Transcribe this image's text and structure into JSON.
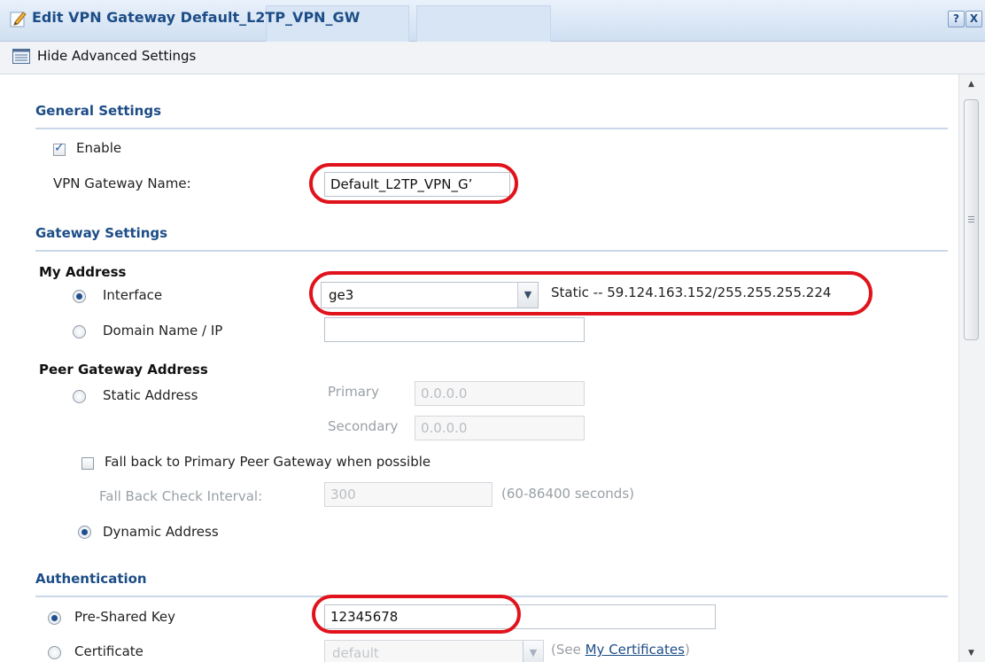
{
  "window": {
    "title": "Edit VPN Gateway Default_L2TP_VPN_GW",
    "help_label": "?",
    "close_label": "X"
  },
  "toolbar": {
    "toggle_label": "Hide Advanced Settings"
  },
  "general": {
    "heading": "General Settings",
    "enable_label": "Enable",
    "enable_checked": true,
    "name_label": "VPN Gateway Name:",
    "name_value": "Default_L2TP_VPN_Gʼ"
  },
  "gateway": {
    "heading": "Gateway Settings",
    "my_address_label": "My Address",
    "interface_label": "Interface",
    "interface_value": "ge3",
    "interface_info": "Static -- 59.124.163.152/255.255.255.224",
    "domain_label": "Domain Name / IP",
    "domain_value": "",
    "peer_label": "Peer Gateway Address",
    "static_label": "Static Address",
    "primary_label": "Primary",
    "primary_value": "0.0.0.0",
    "secondary_label": "Secondary",
    "secondary_value": "0.0.0.0",
    "fallback_label": "Fall back to Primary Peer Gateway when possible",
    "fallback_interval_label": "Fall Back Check Interval:",
    "fallback_interval_value": "300",
    "fallback_range": "(60-86400 seconds)",
    "dynamic_label": "Dynamic Address"
  },
  "auth": {
    "heading": "Authentication",
    "psk_label": "Pre-Shared Key",
    "psk_value": "12345678",
    "cert_label": "Certificate",
    "cert_value": "default",
    "cert_hint_prefix": "(See ",
    "cert_hint_link": "My Certificates",
    "cert_hint_suffix": ")"
  },
  "colors": {
    "accent": "#1d4d87",
    "annotation": "#e0131c"
  }
}
